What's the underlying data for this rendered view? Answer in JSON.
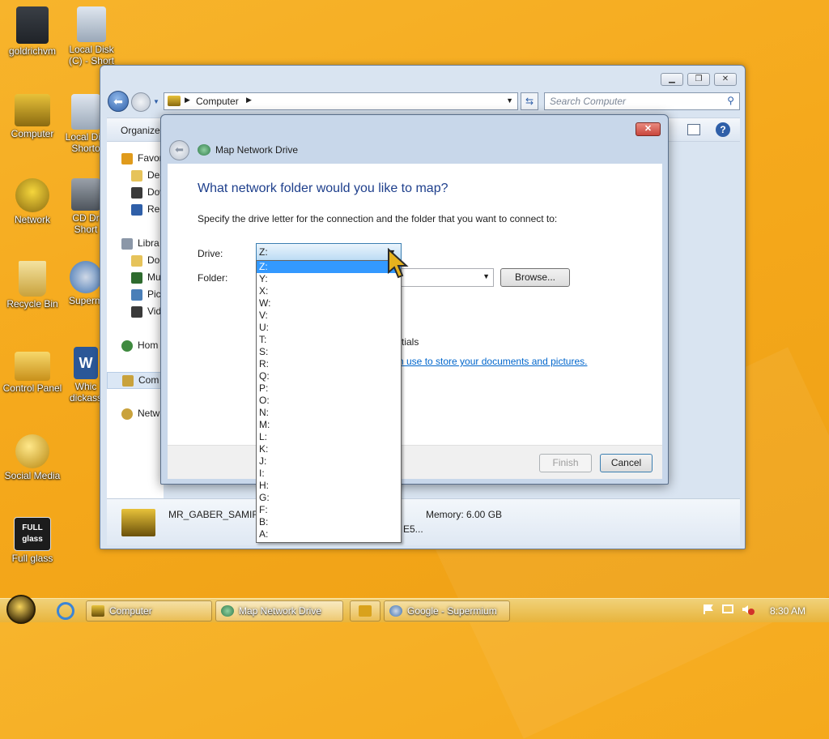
{
  "desktop": {
    "icons": [
      {
        "label": "goldrichvm"
      },
      {
        "label": "Local Disk (C) - Short"
      },
      {
        "label": "Computer"
      },
      {
        "label": "Local Di - Shorto"
      },
      {
        "label": "Network"
      },
      {
        "label": "CD Dr Short"
      },
      {
        "label": "Recycle Bin"
      },
      {
        "label": "Superm"
      },
      {
        "label": "Control Panel"
      },
      {
        "label": "Whic dickass"
      },
      {
        "label": "Social Media"
      },
      {
        "label": "Full glass"
      }
    ],
    "fullglass_badge": "FULL glass"
  },
  "explorer": {
    "address": "Computer",
    "search_placeholder": "Search Computer",
    "organize_label": "Organize",
    "nav": {
      "favorites": "Favor",
      "desktop": "Des",
      "downloads": "Dow",
      "recent": "Rec",
      "libraries": "Libra",
      "documents": "Doc",
      "music": "Mu",
      "pictures": "Pic",
      "videos": "Vid",
      "homegroup": "Hom",
      "computer": "Com",
      "network": "Netw"
    },
    "details": {
      "name": "MR_GABER_SAMIR",
      "memory": "Memory: 6.00 GB",
      "processor_fragment": "E5..."
    }
  },
  "dialog": {
    "title": "Map Network Drive",
    "heading": "What network folder would you like to map?",
    "instruction": "Specify the drive letter for the connection and the folder that you want to connect to:",
    "drive_label": "Drive:",
    "drive_value": "Z:",
    "folder_label": "Folder:",
    "browse_label": "Browse...",
    "credentials_fragment": "tials",
    "link_fragment": "n use to store your documents and pictures.",
    "finish_label": "Finish",
    "cancel_label": "Cancel",
    "drive_options": [
      "Z:",
      "Y:",
      "X:",
      "W:",
      "V:",
      "U:",
      "T:",
      "S:",
      "R:",
      "Q:",
      "P:",
      "O:",
      "N:",
      "M:",
      "L:",
      "K:",
      "J:",
      "I:",
      "H:",
      "G:",
      "F:",
      "B:",
      "A:"
    ],
    "selected_option": "Z:"
  },
  "taskbar": {
    "items": [
      {
        "label": "Computer"
      },
      {
        "label": "Map Network Drive"
      },
      {
        "label": ""
      },
      {
        "label": "Google - Supermium"
      }
    ],
    "time": "8:30 AM"
  },
  "colors": {
    "desktop": "#f5a91c",
    "selection": "#3399ff",
    "heading": "#1e3f8c",
    "link": "#0066cc",
    "close_button": "#c9463d"
  }
}
